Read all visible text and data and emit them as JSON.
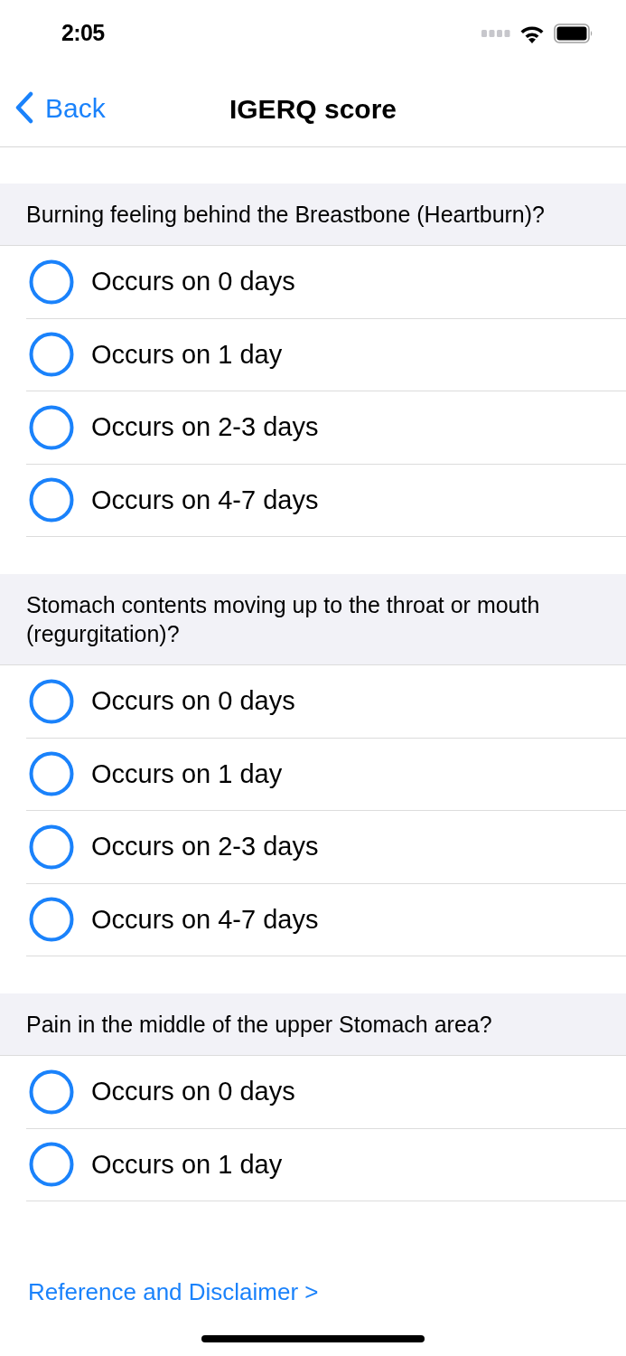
{
  "status_bar": {
    "time": "2:05"
  },
  "nav": {
    "back": "Back",
    "title": "IGERQ score"
  },
  "questions": [
    {
      "text": "Burning feeling behind the Breastbone (Heartburn)?",
      "options": [
        {
          "label": "Occurs on 0 days",
          "selected": false
        },
        {
          "label": "Occurs on 1 day",
          "selected": false
        },
        {
          "label": "Occurs on 2-3 days",
          "selected": false
        },
        {
          "label": "Occurs on 4-7 days",
          "selected": false
        }
      ]
    },
    {
      "text": "Stomach contents moving up to the throat or mouth (regurgitation)?",
      "options": [
        {
          "label": "Occurs on 0 days",
          "selected": false
        },
        {
          "label": "Occurs on 1 day",
          "selected": false
        },
        {
          "label": "Occurs on 2-3 days",
          "selected": false
        },
        {
          "label": "Occurs on 4-7 days",
          "selected": false
        }
      ]
    },
    {
      "text": "Pain in the middle of the upper Stomach area?",
      "options": [
        {
          "label": "Occurs on 0 days",
          "selected": false
        },
        {
          "label": "Occurs on 1 day",
          "selected": false
        }
      ]
    }
  ],
  "footer_link": "Reference and Disclaimer >"
}
